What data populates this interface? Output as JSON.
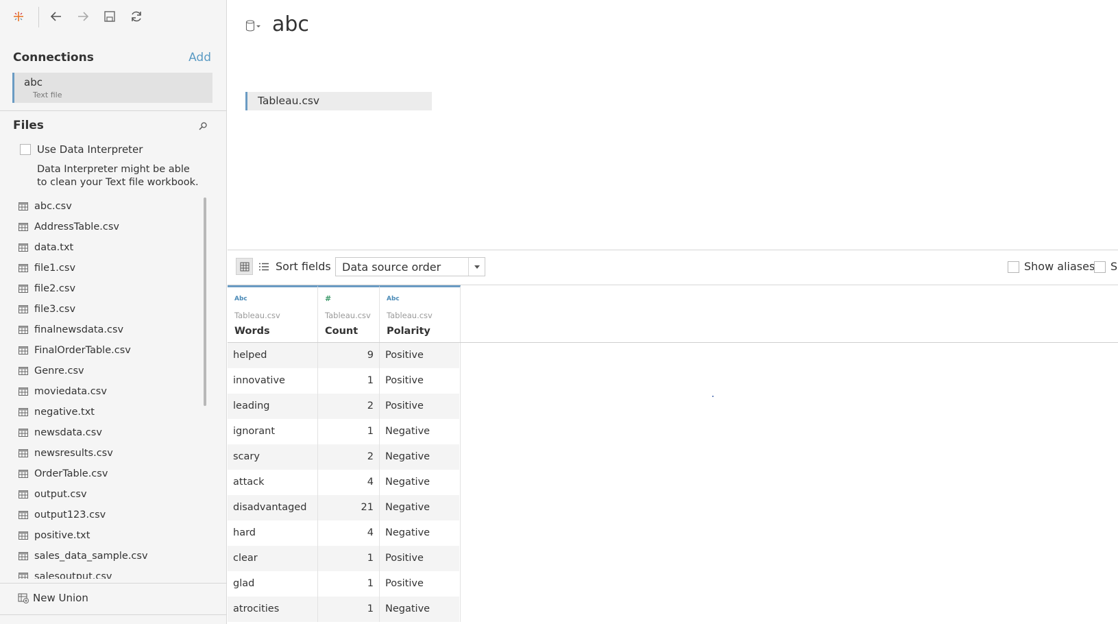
{
  "toolbar": {
    "icons": [
      "tableau-logo-icon",
      "back-arrow-icon",
      "forward-arrow-icon",
      "save-icon",
      "refresh-icon"
    ]
  },
  "connections": {
    "title": "Connections",
    "add_label": "Add",
    "items": [
      {
        "name": "abc",
        "type": "Text file"
      }
    ]
  },
  "files": {
    "title": "Files",
    "use_interpreter_label": "Use Data Interpreter",
    "interpreter_desc": "Data Interpreter might be able to clean your Text file workbook.",
    "items": [
      "abc.csv",
      "AddressTable.csv",
      "data.txt",
      "file1.csv",
      "file2.csv",
      "file3.csv",
      "finalnewsdata.csv",
      "FinalOrderTable.csv",
      "Genre.csv",
      "moviedata.csv",
      "negative.txt",
      "newsdata.csv",
      "newsresults.csv",
      "OrderTable.csv",
      "output.csv",
      "output123.csv",
      "positive.txt",
      "sales_data_sample.csv",
      "salesoutput.csv"
    ],
    "new_union_label": "New Union"
  },
  "datasource": {
    "title": "abc",
    "canvas_table": "Tableau.csv"
  },
  "grid_toolbar": {
    "sort_label": "Sort fields",
    "sort_value": "Data source order",
    "show_aliases_label": "Show aliases",
    "show_hidden_label": "Sh"
  },
  "grid": {
    "columns": [
      {
        "type_icon": "Abc",
        "source": "Tableau.csv",
        "name": "Words"
      },
      {
        "type_icon": "#",
        "source": "Tableau.csv",
        "name": "Count"
      },
      {
        "type_icon": "Abc",
        "source": "Tableau.csv",
        "name": "Polarity"
      }
    ],
    "rows": [
      [
        "helped",
        "9",
        "Positive"
      ],
      [
        "innovative",
        "1",
        "Positive"
      ],
      [
        "leading",
        "2",
        "Positive"
      ],
      [
        "ignorant",
        "1",
        "Negative"
      ],
      [
        "scary",
        "2",
        "Negative"
      ],
      [
        "attack",
        "4",
        "Negative"
      ],
      [
        "disadvantaged",
        "21",
        "Negative"
      ],
      [
        "hard",
        "4",
        "Negative"
      ],
      [
        "clear",
        "1",
        "Positive"
      ],
      [
        "glad",
        "1",
        "Positive"
      ],
      [
        "atrocities",
        "1",
        "Negative"
      ]
    ]
  },
  "colors": {
    "accent": "#6a9bc3",
    "add_link": "#5b9bc4",
    "sidebar_bg": "#f5f5f5"
  }
}
